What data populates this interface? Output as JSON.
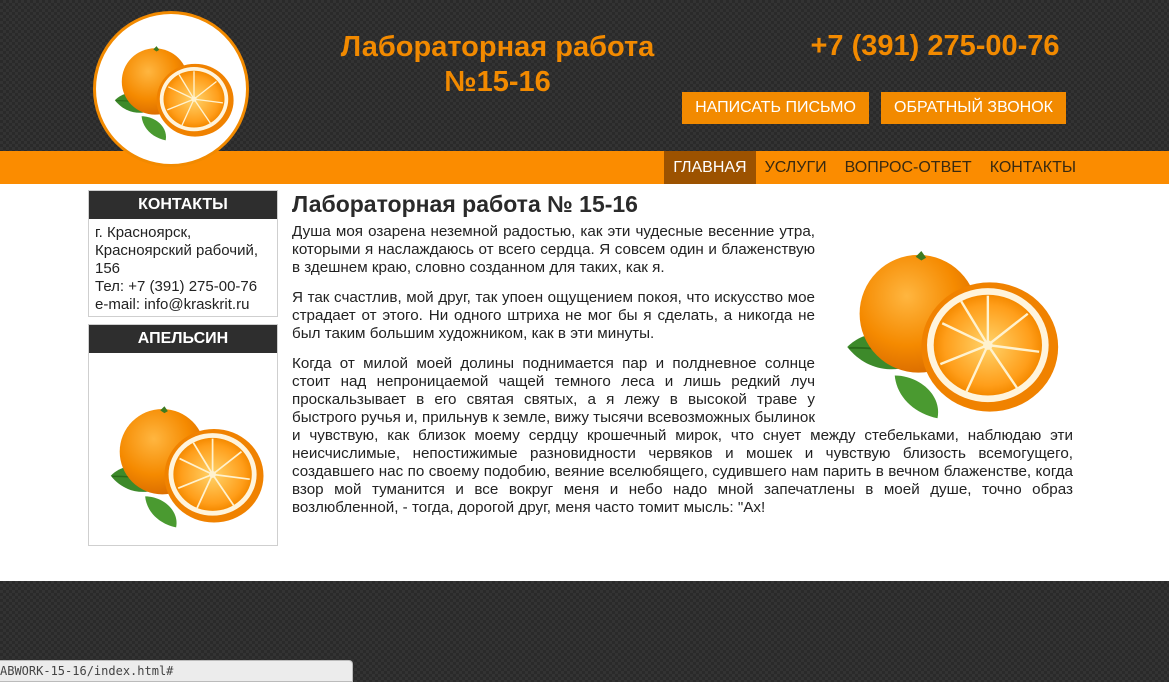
{
  "header": {
    "title_line1": "Лабораторная работа",
    "title_line2": "№15-16",
    "phone": "+7 (391) 275-00-76",
    "btn_write": "НАПИСАТЬ ПИСЬМО",
    "btn_callback": "ОБРАТНЫЙ ЗВОНОК",
    "logo_icon": "orange-icon"
  },
  "nav": {
    "items": [
      "ГЛАВНАЯ",
      "УСЛУГИ",
      "ВОПРОС-ОТВЕТ",
      "КОНТАКТЫ"
    ],
    "active": "ГЛАВНАЯ"
  },
  "sidebar": {
    "contacts_title": "КОНТАКТЫ",
    "address_line1": "г. Красноярск,",
    "address_line2": "Красноярский рабочий,",
    "address_line3": "156",
    "phone_line": "Тел: +7 (391) 275-00-76",
    "email_line": "e-mail: info@kraskrit.ru",
    "orange_title": "АПЕЛЬСИН"
  },
  "main": {
    "heading": "Лабораторная работа № 15-16",
    "p1": "Душа моя озарена неземной радостью, как эти чудесные весенние утра, которыми я наслаждаюсь от всего сердца. Я совсем один и блаженствую в здешнем краю, словно созданном для таких, как я.",
    "p2": "Я так счастлив, мой друг, так упоен ощущением покоя, что искусство мое страдает от этого. Ни одного штриха не мог бы я сделать, а никогда не был таким большим художником, как в эти минуты.",
    "p3": "Когда от милой моей долины поднимается пар и полдневное солнце стоит над непроницаемой чащей темного леса и лишь редкий луч проскальзывает в его святая святых, а я лежу в высокой траве у быстрого ручья и, прильнув к земле, вижу тысячи всевозможных былинок и чувствую, как близок моему сердцу крошечный мирок, что снует между стебельками, наблюдаю эти неисчислимые, непостижимые разновидности червяков и мошек и чувствую близость всемогущего, создавшего нас по своему подобию, веяние вселюбящего, судившего нам парить в вечном блаженстве, когда взор мой туманится и все вокруг меня и небо надо мной запечатлены в моей душе, точно образ возлюбленной, - тогда, дорогой друг, меня часто томит мысль: \"Ах!"
  },
  "statusbar": {
    "url": "ABWORK-15-16/index.html#"
  },
  "colors": {
    "accent": "#f28a00",
    "nav_bg": "#fb8c00",
    "nav_active": "#9c5200",
    "dark": "#2e2e2e"
  }
}
